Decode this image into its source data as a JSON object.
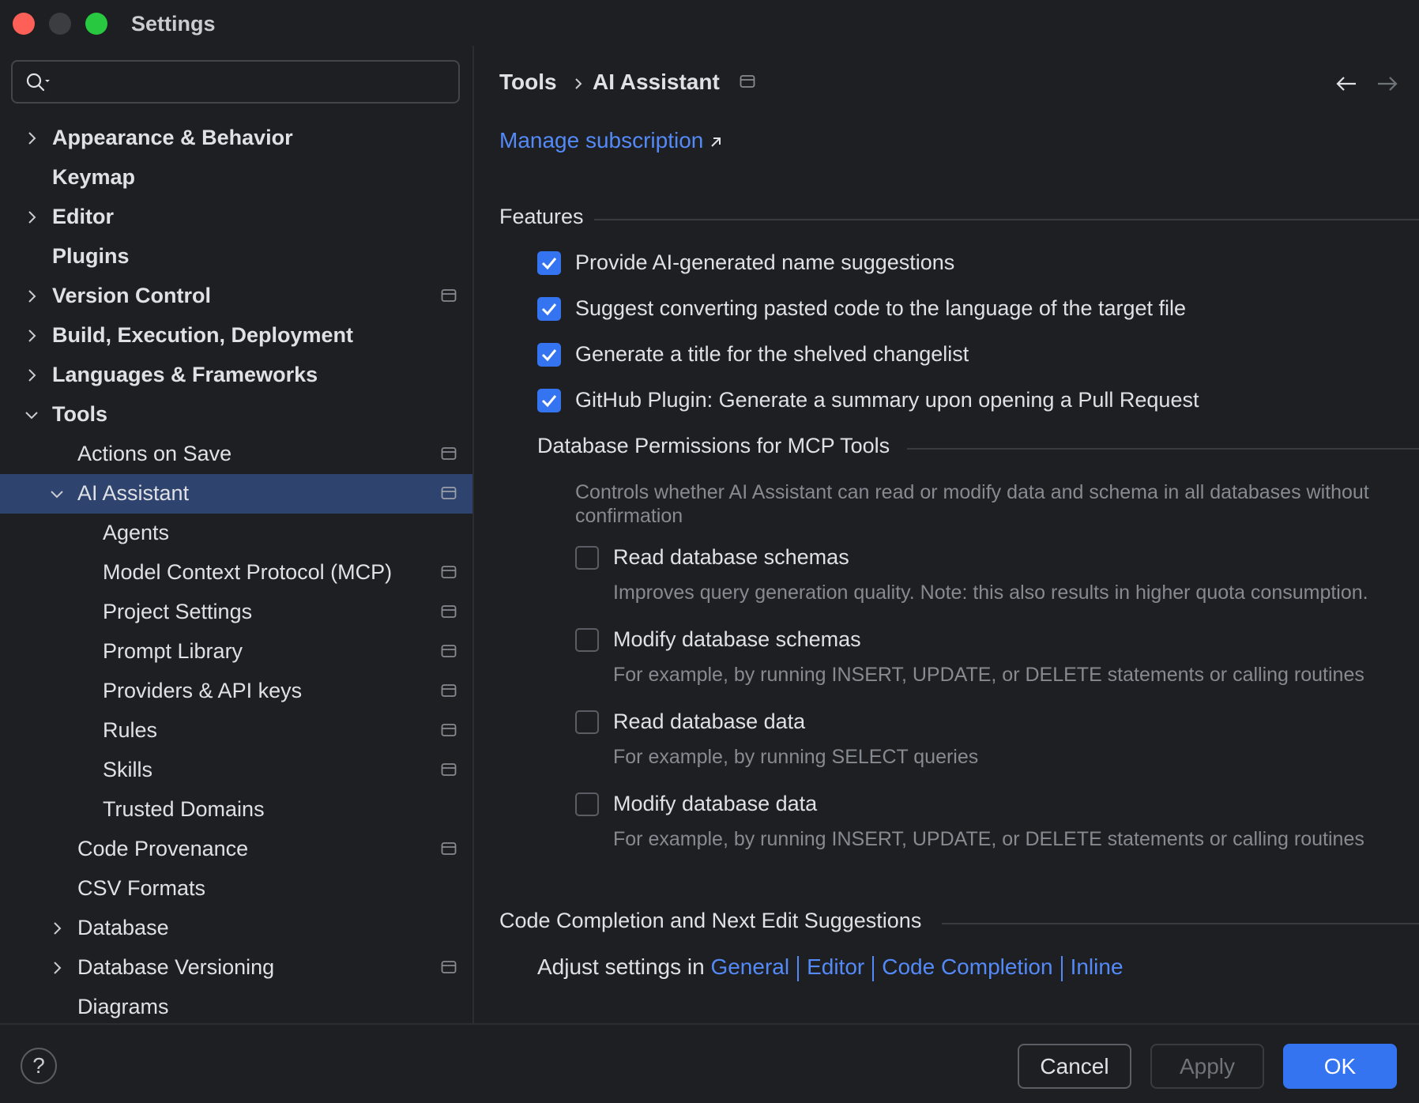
{
  "window": {
    "title": "Settings"
  },
  "search": {
    "placeholder": ""
  },
  "sidebar": {
    "items": [
      {
        "label": "Appearance & Behavior"
      },
      {
        "label": "Keymap"
      },
      {
        "label": "Editor"
      },
      {
        "label": "Plugins"
      },
      {
        "label": "Version Control"
      },
      {
        "label": "Build, Execution, Deployment"
      },
      {
        "label": "Languages & Frameworks"
      },
      {
        "label": "Tools"
      },
      {
        "label": "Actions on Save"
      },
      {
        "label": "AI Assistant"
      },
      {
        "label": "Agents"
      },
      {
        "label": "Model Context Protocol (MCP)"
      },
      {
        "label": "Project Settings"
      },
      {
        "label": "Prompt Library"
      },
      {
        "label": "Providers & API keys"
      },
      {
        "label": "Rules"
      },
      {
        "label": "Skills"
      },
      {
        "label": "Trusted Domains"
      },
      {
        "label": "Code Provenance"
      },
      {
        "label": "CSV Formats"
      },
      {
        "label": "Database"
      },
      {
        "label": "Database Versioning"
      },
      {
        "label": "Diagrams"
      }
    ],
    "selected": "AI Assistant"
  },
  "breadcrumb": {
    "parent": "Tools",
    "current": "AI Assistant"
  },
  "main": {
    "manage_subscription": "Manage subscription",
    "features": {
      "title": "Features",
      "options": [
        {
          "label": "Provide AI-generated name suggestions",
          "checked": true
        },
        {
          "label": "Suggest converting pasted code to the language of the target file",
          "checked": true
        },
        {
          "label": "Generate a title for the shelved changelist",
          "checked": true
        },
        {
          "label": "GitHub Plugin: Generate a summary upon opening a Pull Request",
          "checked": true
        }
      ]
    },
    "db_permissions": {
      "title": "Database Permissions for MCP Tools",
      "description_line1": "Controls whether AI Assistant can read or modify data and schema in all databases without",
      "description_line2": "confirmation",
      "options": [
        {
          "label": "Read database schemas",
          "hint": "Improves query generation quality. Note: this also results in higher quota consumption.",
          "checked": false
        },
        {
          "label": "Modify database schemas",
          "hint": "For example, by running INSERT, UPDATE, or DELETE statements or calling routines",
          "checked": false
        },
        {
          "label": "Read database data",
          "hint": "For example, by running SELECT queries",
          "checked": false
        },
        {
          "label": "Modify database data",
          "hint": "For example, by running INSERT, UPDATE, or DELETE statements or calling routines",
          "checked": false
        }
      ]
    },
    "code_completion": {
      "title": "Code Completion and Next Edit Suggestions",
      "adjust_prefix": "Adjust settings in",
      "links": [
        "General",
        "Editor",
        "Code Completion",
        "Inline"
      ]
    }
  },
  "buttons": {
    "help": "?",
    "cancel": "Cancel",
    "apply": "Apply",
    "ok": "OK"
  },
  "colors": {
    "accent": "#3574f0",
    "link": "#548af7",
    "selection": "#2e436e",
    "background": "#1e1f22"
  }
}
